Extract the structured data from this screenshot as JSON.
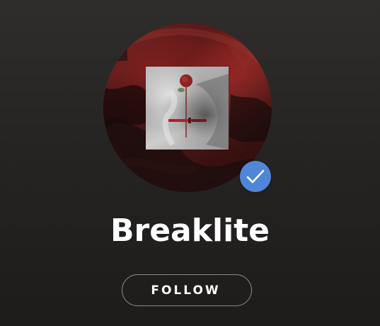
{
  "artist": {
    "name": "Breaklite",
    "verified": true
  },
  "actions": {
    "follow_label": "FOLLOW"
  },
  "icons": {
    "verified": "check-icon"
  },
  "colors": {
    "background": "#262423",
    "verified_badge": "#4f86d8",
    "text": "#ffffff",
    "button_border": "#8b8886"
  }
}
